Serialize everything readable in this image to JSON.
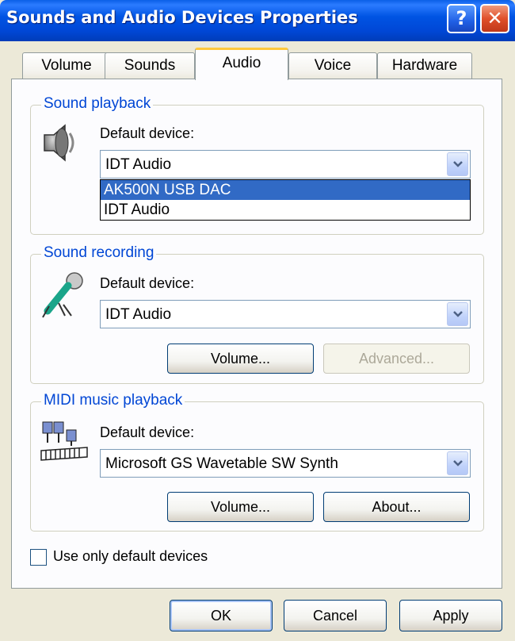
{
  "window": {
    "title": "Sounds and Audio Devices Properties",
    "help_label": "?",
    "close_label": "✕"
  },
  "tabs": [
    {
      "label": "Volume"
    },
    {
      "label": "Sounds"
    },
    {
      "label": "Audio",
      "active": true
    },
    {
      "label": "Voice"
    },
    {
      "label": "Hardware"
    }
  ],
  "playback": {
    "group_label": "Sound playback",
    "device_label": "Default device:",
    "selected": "IDT Audio",
    "icon": "speaker-icon",
    "dropdown_options": [
      "AK500N USB DAC",
      "IDT Audio"
    ]
  },
  "recording": {
    "group_label": "Sound recording",
    "device_label": "Default device:",
    "selected": "IDT Audio",
    "icon": "microphone-icon",
    "volume_button": "Volume...",
    "advanced_button": "Advanced..."
  },
  "midi": {
    "group_label": "MIDI music playback",
    "device_label": "Default device:",
    "selected": "Microsoft GS Wavetable SW Synth",
    "icon": "midi-keyboard-icon",
    "volume_button": "Volume...",
    "about_button": "About..."
  },
  "options": {
    "use_default_only": "Use only default devices",
    "use_default_checked": false
  },
  "footer": {
    "ok": "OK",
    "cancel": "Cancel",
    "apply": "Apply"
  },
  "colors": {
    "titlebar": "#0054e3",
    "selection": "#316ac5",
    "group_label": "#0046d5",
    "tab_highlight": "#ffc83c"
  }
}
